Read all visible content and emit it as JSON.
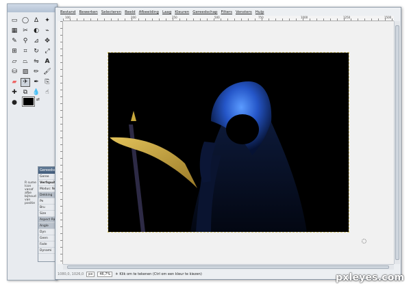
{
  "menu": [
    "Bestand",
    "Bewerken",
    "Selecteren",
    "Beeld",
    "Afbeelding",
    "Laag",
    "Kleuren",
    "Gereedschap",
    "Filters",
    "Vensters",
    "Hulp"
  ],
  "ruler_labels": [
    "100",
    "200",
    "250",
    "500",
    "750",
    "1000",
    "1250",
    "1500"
  ],
  "status": {
    "coords": "1080,0, 1026,0",
    "unit": "px",
    "zoom": "46,7%",
    "message": "Klik om te tekenen (Ctrl om een kleur te kiezen)"
  },
  "dock": {
    "title": "Gereedschap",
    "rows": [
      "Geree",
      "Verfspuit",
      "Modus: No",
      "Dekking",
      "Pe",
      "Bru",
      "Size",
      "Aspect Rat",
      "Angle",
      "Dyn",
      "Geen",
      "Fade",
      "Dynami"
    ]
  },
  "left_snip": "R sume Icon vanaf afbe bijhoud van positie",
  "watermark": "pxleyes.com",
  "colors": {
    "foreground": "#000000",
    "background": "#ffffff",
    "scythe": "#c8a83c",
    "hood": "#2f6fe0"
  },
  "tools": [
    "rect-select",
    "ellipse-select",
    "free-select",
    "fuzzy-select",
    "color-select",
    "scissors",
    "foreground-select",
    "paths",
    "color-picker",
    "zoom",
    "measure",
    "move",
    "align",
    "crop",
    "rotate",
    "scale",
    "shear",
    "perspective",
    "flip",
    "text",
    "bucket-fill",
    "blend",
    "pencil",
    "paintbrush",
    "eraser",
    "airbrush",
    "ink",
    "clone",
    "heal",
    "perspective-clone",
    "blur",
    "smudge",
    "dodge-burn"
  ]
}
